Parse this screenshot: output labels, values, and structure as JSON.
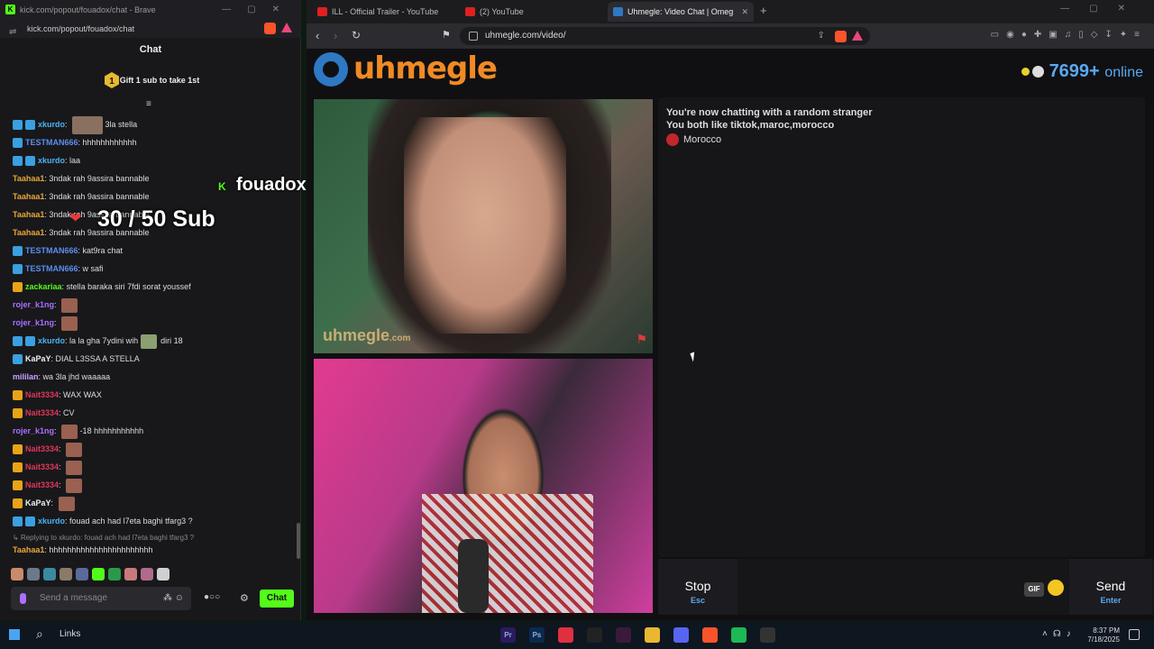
{
  "kick": {
    "window_title": "kick.com/popout/fouadox/chat - Brave",
    "url": "kick.com/popout/fouadox/chat",
    "chat_header": "Chat",
    "gift_badge": "1",
    "gift_text": "Gift 1 sub to take 1st",
    "messages": [
      {
        "user": "xkurdo",
        "text": "3la stella",
        "color": "#4ab3f4",
        "badges": [
          "blue",
          "blue"
        ],
        "emote": "wide"
      },
      {
        "user": "TESTMAN666",
        "text": "hhhhhhhhhhhh",
        "color": "#5b8ef0",
        "badges": [
          "blue"
        ],
        "emote": ""
      },
      {
        "user": "xkurdo",
        "text": "laa",
        "color": "#4ab3f4",
        "badges": [
          "blue",
          "blue"
        ],
        "emote": ""
      },
      {
        "user": "Taahaa1",
        "text": "3ndak rah 9assira bannable",
        "color": "#e8a63a",
        "badges": [],
        "emote": ""
      },
      {
        "user": "Taahaa1",
        "text": "3ndak rah 9assira bannable",
        "color": "#e8a63a",
        "badges": [],
        "emote": ""
      },
      {
        "user": "Taahaa1",
        "text": "3ndak rah 9assira bannable",
        "color": "#e8a63a",
        "badges": [],
        "emote": ""
      },
      {
        "user": "Taahaa1",
        "text": "3ndak rah 9assira bannable",
        "color": "#e8a63a",
        "badges": [],
        "emote": ""
      },
      {
        "user": "TESTMAN666",
        "text": "kat9ra chat",
        "color": "#5b8ef0",
        "badges": [
          "blue"
        ],
        "emote": ""
      },
      {
        "user": "TESTMAN666",
        "text": "w safi",
        "color": "#5b8ef0",
        "badges": [
          "blue"
        ],
        "emote": ""
      },
      {
        "user": "zackariaa",
        "text": "stella baraka siri 7fdi sorat youssef",
        "color": "#53fc18",
        "badges": [
          "gold"
        ],
        "emote": ""
      },
      {
        "user": "rojer_k1ng",
        "text": "",
        "color": "#a970ff",
        "badges": [],
        "emote": "small"
      },
      {
        "user": "rojer_k1ng",
        "text": "",
        "color": "#a970ff",
        "badges": [],
        "emote": "small"
      },
      {
        "user": "xkurdo",
        "text": "la la gha 7ydini wih",
        "color": "#4ab3f4",
        "badges": [
          "blue",
          "blue"
        ],
        "emote": "after",
        "after": "diri 18"
      },
      {
        "user": "KaPaY",
        "text": "DIAL L3SSA A STELLA",
        "color": "#f0f0f0",
        "badges": [
          "blue"
        ],
        "emote": ""
      },
      {
        "user": "mililan",
        "text": "wa 3la jhd waaaaa",
        "color": "#c9a0ff",
        "badges": [],
        "emote": ""
      },
      {
        "user": "Nait3334",
        "text": "WAX WAX",
        "color": "#e0365a",
        "badges": [
          "gold"
        ],
        "emote": ""
      },
      {
        "user": "Nait3334",
        "text": "CV",
        "color": "#e0365a",
        "badges": [
          "gold"
        ],
        "emote": ""
      },
      {
        "user": "rojer_k1ng",
        "text": "-18 hhhhhhhhhhh",
        "color": "#a970ff",
        "badges": [],
        "emote": "before"
      },
      {
        "user": "Nait3334",
        "text": "",
        "color": "#e0365a",
        "badges": [
          "gold"
        ],
        "emote": "small"
      },
      {
        "user": "Nait3334",
        "text": "",
        "color": "#e0365a",
        "badges": [
          "gold"
        ],
        "emote": "small"
      },
      {
        "user": "Nait3334",
        "text": "",
        "color": "#e0365a",
        "badges": [
          "gold"
        ],
        "emote": "small"
      },
      {
        "user": "KaPaY",
        "text": "",
        "color": "#f0f0f0",
        "badges": [
          "gold"
        ],
        "emote": "small"
      },
      {
        "user": "xkurdo",
        "text": "fouad ach had l7eta baghi tfarg3 ?",
        "color": "#4ab3f4",
        "badges": [
          "blue",
          "blue"
        ],
        "emote": ""
      }
    ],
    "reply_hint": "Replying to xkurdo: fouad ach had l7eta baghi tfarg3 ?",
    "last_message": {
      "user": "Taahaa1",
      "text": "hhhhhhhhhhhhhhhhhhhhhhh",
      "color": "#e8a63a"
    },
    "input_placeholder": "Send a message",
    "chat_button": "Chat"
  },
  "overlay": {
    "streamer": "fouadox",
    "subs": "30 / 50 Sub"
  },
  "browser": {
    "tabs": [
      {
        "title": "ILL - Official Trailer - YouTube",
        "color": "#e02020",
        "active": false
      },
      {
        "title": "(2) YouTube",
        "color": "#e02020",
        "active": false
      },
      {
        "title": "Uhmegle: Video Chat | Omeg",
        "color": "#2f78c4",
        "active": true
      }
    ],
    "url": "uhmegle.com/video/"
  },
  "uhmegle": {
    "logo": "uhmegle",
    "online_count": "7699+",
    "online_label": "online",
    "watermark": "uhmegle",
    "watermark_tld": ".com",
    "status_line1": "You're now chatting with a random stranger",
    "status_line2": "You both like tiktok,maroc,morocco",
    "country": "Morocco",
    "stop_label": "Stop",
    "stop_key": "Esc",
    "gif_label": "GIF",
    "send_label": "Send",
    "send_key": "Enter"
  },
  "taskbar": {
    "links": "Links",
    "time": "8:37 PM",
    "date": "7/18/2025",
    "apps": [
      {
        "name": "premiere-icon",
        "color": "#2a1a5e",
        "glyph": "Pr"
      },
      {
        "name": "photoshop-icon",
        "color": "#0a2a4e",
        "glyph": "Ps"
      },
      {
        "name": "switch-icon",
        "color": "#e03040",
        "glyph": ""
      },
      {
        "name": "capcut-icon",
        "color": "#222",
        "glyph": ""
      },
      {
        "name": "vegas-icon",
        "color": "#3a1a3a",
        "glyph": ""
      },
      {
        "name": "folder-icon",
        "color": "#e8b830",
        "glyph": ""
      },
      {
        "name": "discord-icon",
        "color": "#5865f2",
        "glyph": ""
      },
      {
        "name": "brave-icon",
        "color": "#fb542b",
        "glyph": ""
      },
      {
        "name": "spotify-icon",
        "color": "#1db954",
        "glyph": ""
      },
      {
        "name": "obs-icon",
        "color": "#333",
        "glyph": ""
      }
    ]
  }
}
